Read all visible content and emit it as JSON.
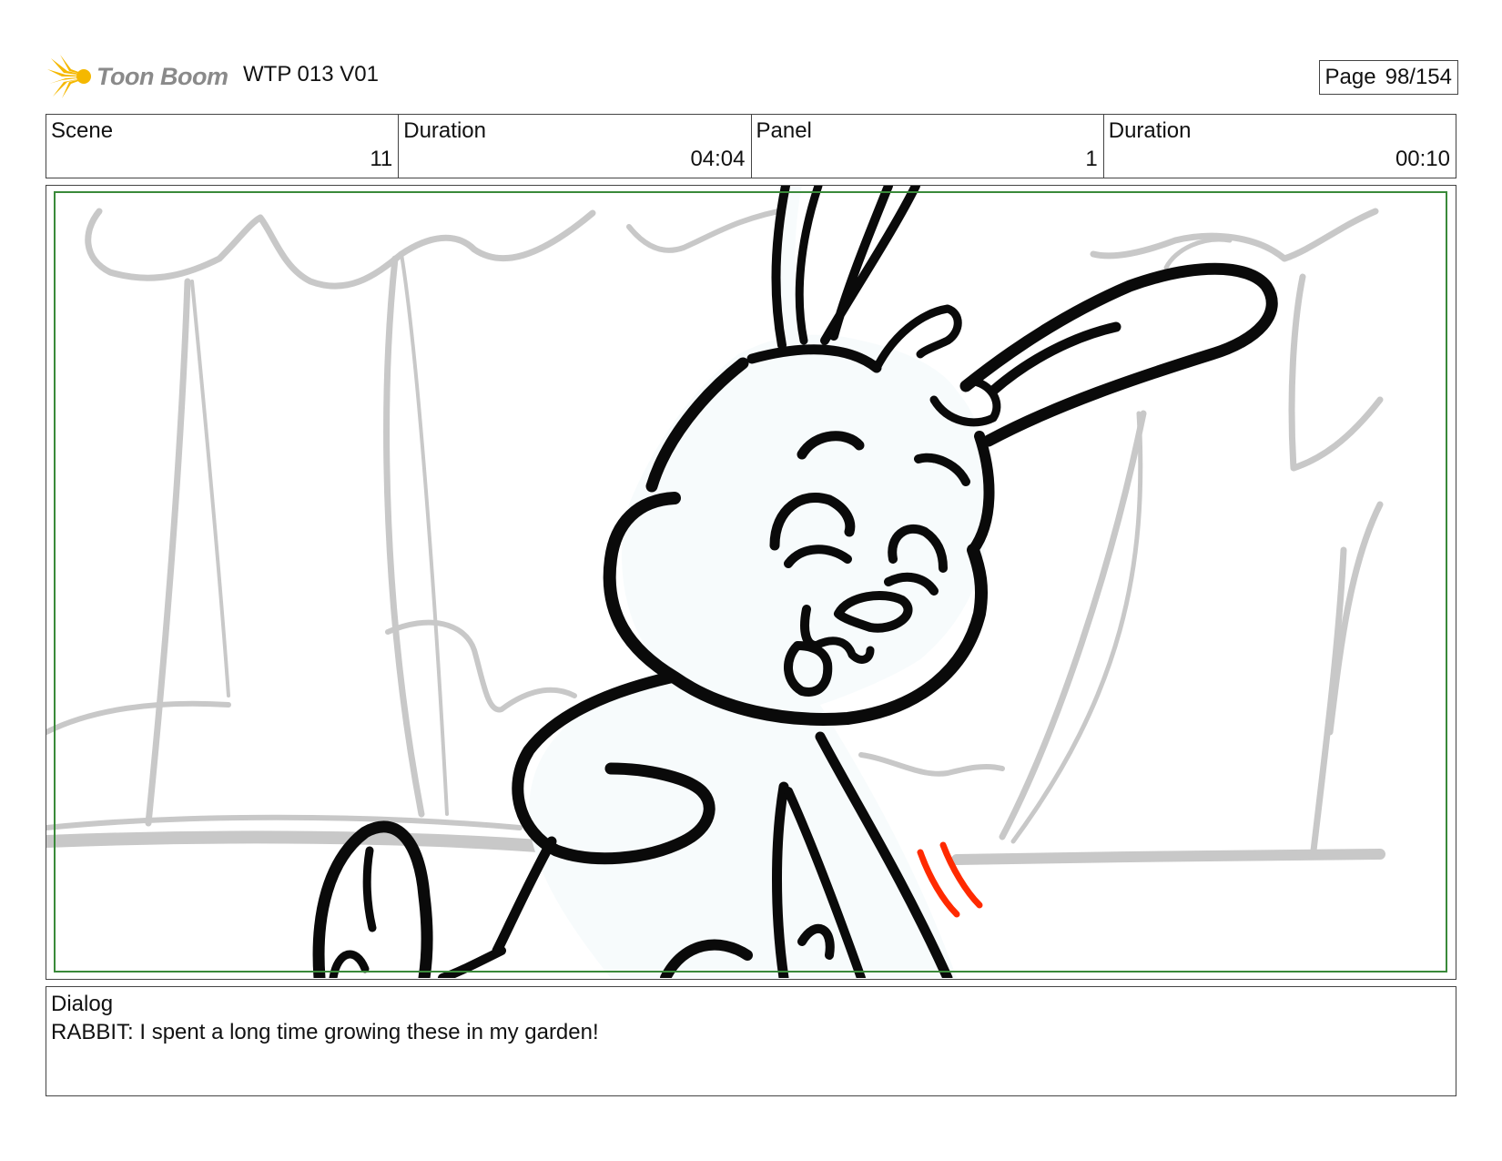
{
  "header": {
    "logo_text": "Toon Boom",
    "title": "WTP 013 V01",
    "page_label": "Page",
    "page_value": "98/154"
  },
  "info": {
    "scene_label": "Scene",
    "scene_value": "11",
    "scene_duration_label": "Duration",
    "scene_duration_value": "04:04",
    "panel_label": "Panel",
    "panel_value": "1",
    "panel_duration_label": "Duration",
    "panel_duration_value": "00:10"
  },
  "dialog": {
    "label": "Dialog",
    "text": "RABBIT: I spent a long time growing these in my garden!"
  },
  "colors": {
    "safe_frame": "#3a8a3a",
    "sketch_gray": "#c8c8c8",
    "ink": "#0a0a0a",
    "accent_red": "#ff2a00",
    "logo_yellow": "#f5b800"
  }
}
